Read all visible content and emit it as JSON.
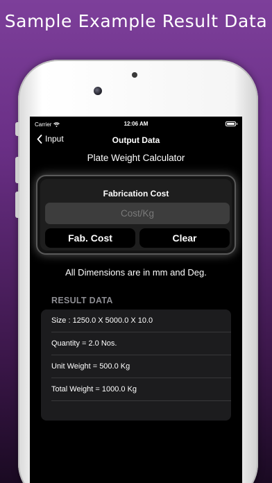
{
  "banner": {
    "title": "Sample Example Result Data"
  },
  "status_bar": {
    "carrier": "Carrier",
    "time": "12:06 AM"
  },
  "nav": {
    "back_label": "Input",
    "title": "Output Data"
  },
  "subtitle": "Plate Weight Calculator",
  "fabrication": {
    "title": "Fabrication Cost",
    "cost_input": {
      "placeholder": "Cost/Kg",
      "value": ""
    },
    "fab_cost_label": "Fab. Cost",
    "clear_label": "Clear"
  },
  "note": "All Dimensions are in mm and Deg.",
  "results": {
    "header": "RESULT DATA",
    "rows": [
      "Size : 1250.0 X 5000.0 X 10.0",
      "Quantity = 2.0 Nos.",
      "Unit Weight = 500.0 Kg",
      "Total Weight = 1000.0 Kg"
    ]
  },
  "colors": {
    "background_top": "#7d3f9a",
    "screen": "#000000",
    "card": "#1e1e1e",
    "input": "#3d3d3d",
    "section_header": "#8e8e93",
    "results_bg": "#1c1c1e"
  }
}
